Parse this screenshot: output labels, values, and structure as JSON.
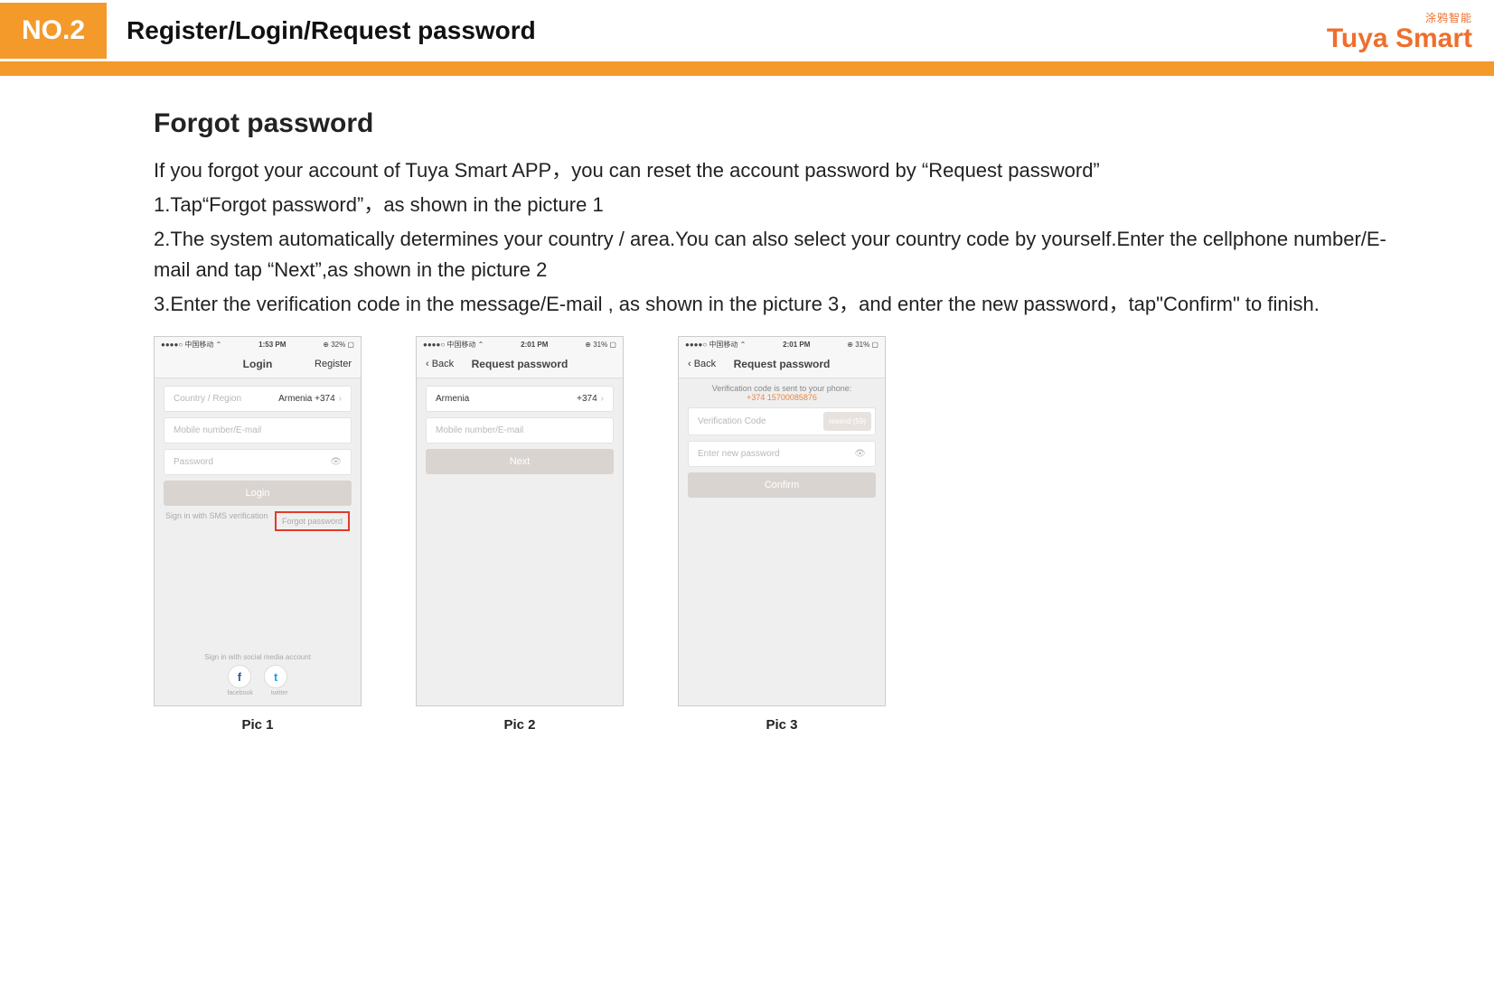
{
  "header": {
    "badge": "NO.2",
    "title": "Register/Login/Request password",
    "logo_cn": "涂鸦智能",
    "logo_main": "Tuya Smart"
  },
  "section": {
    "heading": "Forgot password",
    "intro": "If you forgot your account of Tuya Smart APP，you can reset the account password by “Request password”",
    "step1": "1.Tap“Forgot password”，as shown in the picture 1",
    "step2": "2.The system automatically determines your country / area.You can also select your country code by yourself.Enter the cellphone number/E-mail and tap “Next”,as shown in the picture 2",
    "step3": "3.Enter the verification code in the message/E-mail , as shown in the picture 3，and enter the new password，tap\"Confirm\" to finish."
  },
  "captions": {
    "p1": "Pic 1",
    "p2": "Pic 2",
    "p3": "Pic 3"
  },
  "phone1": {
    "status": {
      "left": "●●●●○ 中国移动 ⌃",
      "time": "1:53 PM",
      "right": "⊕ 32% ▢"
    },
    "nav": {
      "left": "",
      "title": "Login",
      "right": "Register"
    },
    "country_label": "Country / Region",
    "country_value": "Armenia +374",
    "mobile_placeholder": "Mobile number/E-mail",
    "password_placeholder": "Password",
    "login_btn": "Login",
    "sms_link": "Sign in with SMS verification",
    "forgot_link": "Forgot password",
    "social_title": "Sign in with social media account",
    "fb": "f",
    "tw": "t",
    "fb_label": "facebook",
    "tw_label": "twitter"
  },
  "phone2": {
    "status": {
      "left": "●●●●○ 中国移动 ⌃",
      "time": "2:01 PM",
      "right": "⊕ 31% ▢"
    },
    "nav": {
      "left": "‹ Back",
      "title": "Request password",
      "right": ""
    },
    "country_name": "Armenia",
    "country_code": "+374",
    "mobile_placeholder": "Mobile number/E-mail",
    "next_btn": "Next"
  },
  "phone3": {
    "status": {
      "left": "●●●●○ 中国移动 ⌃",
      "time": "2:01 PM",
      "right": "⊕ 31% ▢"
    },
    "nav": {
      "left": "‹ Back",
      "title": "Request password",
      "right": ""
    },
    "hint_text": "Verification code is sent to your phone:",
    "hint_phone": "+374 15700085876",
    "code_placeholder": "Verification Code",
    "resend_btn": "resend (59)",
    "newpw_placeholder": "Enter new password",
    "confirm_btn": "Confirm"
  }
}
